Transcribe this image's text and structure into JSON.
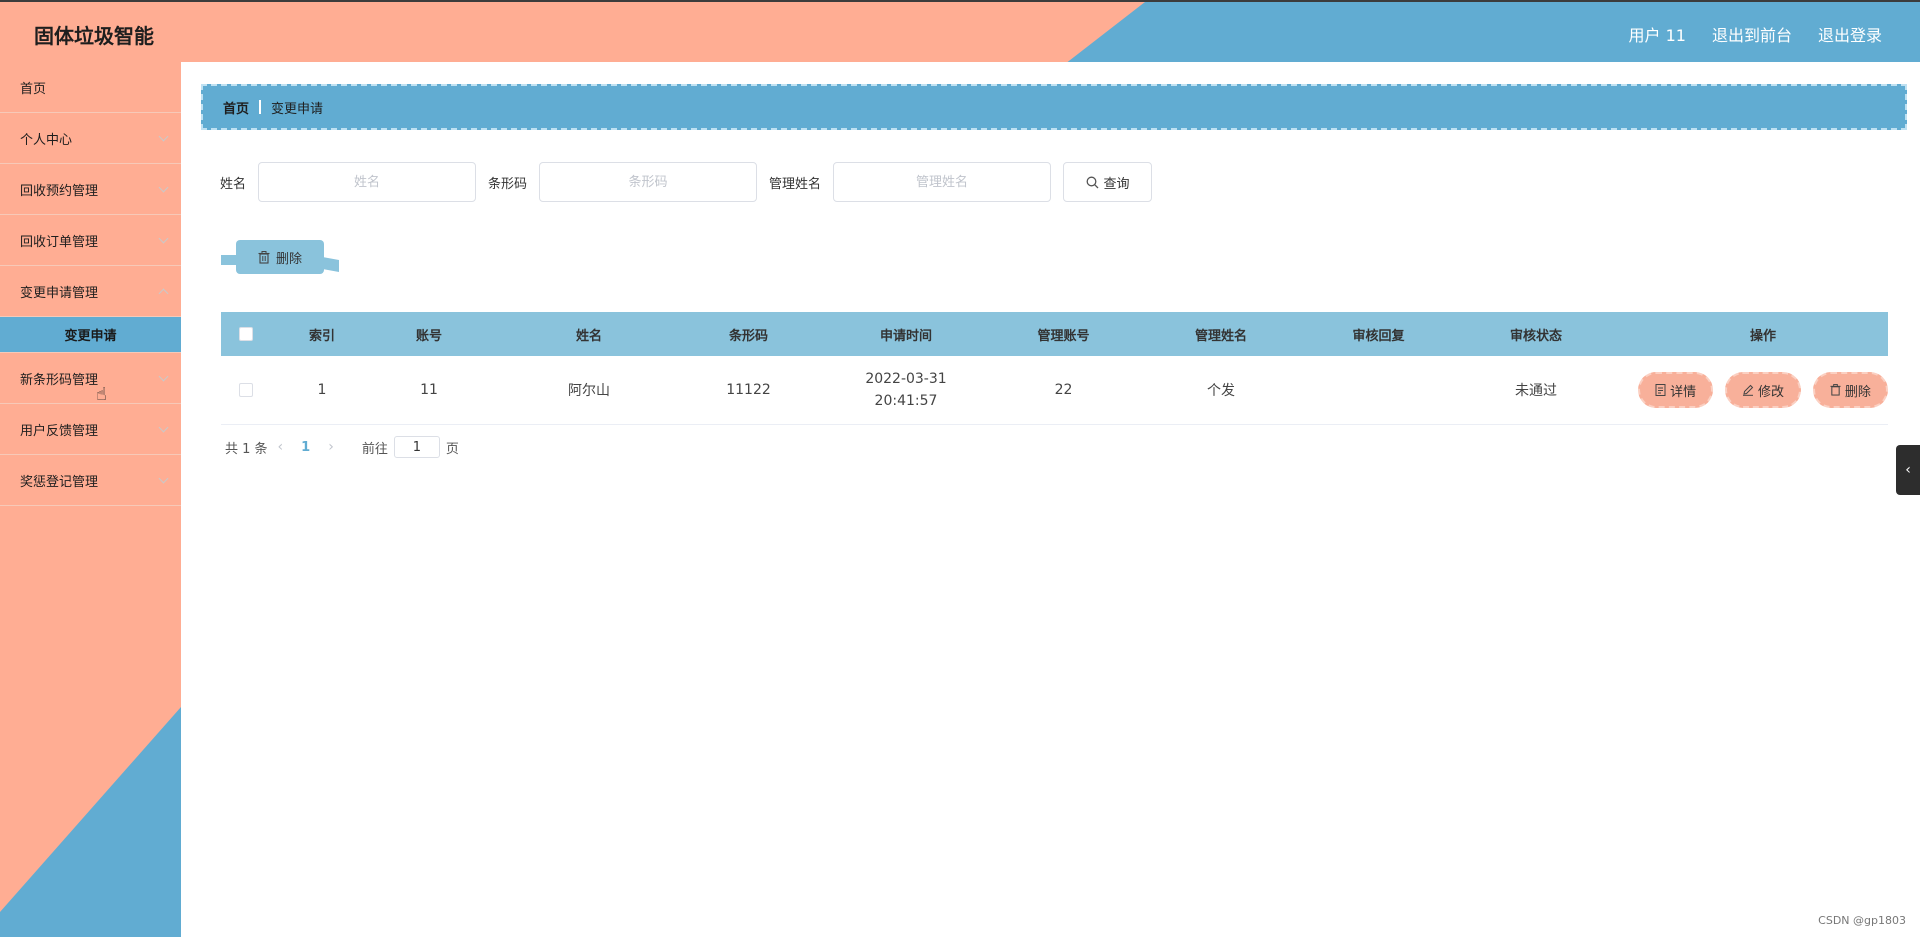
{
  "header": {
    "title": "固体垃圾智能",
    "user_label": "用户 11",
    "to_front_label": "退出到前台",
    "logout_label": "退出登录"
  },
  "sidebar": {
    "items": [
      {
        "label": "首页",
        "has_children": false
      },
      {
        "label": "个人中心",
        "has_children": true
      },
      {
        "label": "回收预约管理",
        "has_children": true
      },
      {
        "label": "回收订单管理",
        "has_children": true
      },
      {
        "label": "变更申请管理",
        "has_children": true,
        "expanded": true
      },
      {
        "label": "新条形码管理",
        "has_children": true
      },
      {
        "label": "用户反馈管理",
        "has_children": true
      },
      {
        "label": "奖惩登记管理",
        "has_children": true
      }
    ],
    "submenu": {
      "label": "变更申请"
    }
  },
  "breadcrumb": {
    "home": "首页",
    "current": "变更申请"
  },
  "search": {
    "name_label": "姓名",
    "name_placeholder": "姓名",
    "barcode_label": "条形码",
    "barcode_placeholder": "条形码",
    "manager_label": "管理姓名",
    "manager_placeholder": "管理姓名",
    "query_label": "查询"
  },
  "toolbar": {
    "delete_label": "删除"
  },
  "table": {
    "headers": [
      "索引",
      "账号",
      "姓名",
      "条形码",
      "申请时间",
      "管理账号",
      "管理姓名",
      "审核回复",
      "审核状态",
      "操作"
    ],
    "rows": [
      {
        "index": "1",
        "account": "11",
        "name": "阿尔山",
        "barcode": "11122",
        "time": "2022-03-31 20:41:57",
        "manager_account": "22",
        "manager_name": "个发",
        "reply": "",
        "status": "未通过"
      }
    ],
    "actions": {
      "detail": "详情",
      "edit": "修改",
      "delete": "删除"
    }
  },
  "pager": {
    "total": "共 1 条",
    "current": "1",
    "goto": "前往",
    "goto_value": "1",
    "page_unit": "页"
  },
  "watermark": "CSDN @gp1803",
  "colors": {
    "salmon": "#ffad93",
    "blue": "#61acd2",
    "light_blue": "#8ac3dc",
    "action": "#f8b09a"
  }
}
